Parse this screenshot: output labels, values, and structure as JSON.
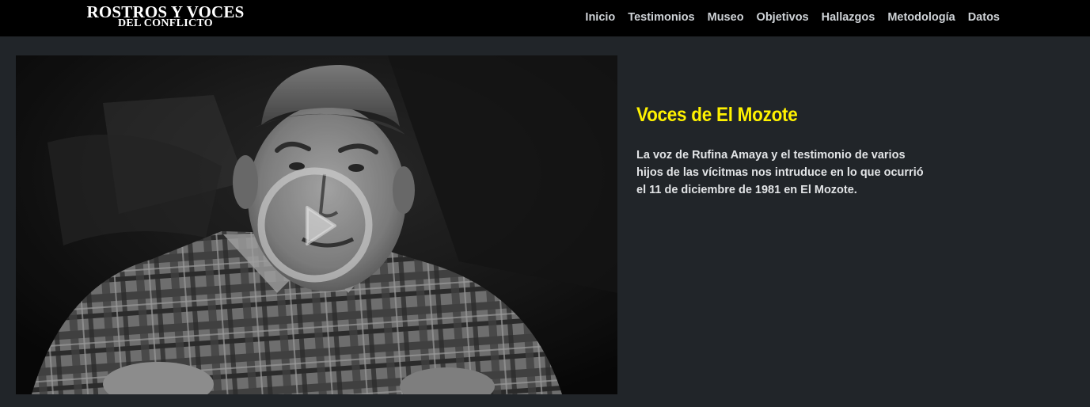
{
  "nav": {
    "logo_line1": "ROSTROS Y VOCES",
    "logo_line2": "DEL CONFLICTO",
    "items": [
      {
        "label": "Inicio"
      },
      {
        "label": "Testimonios"
      },
      {
        "label": "Museo"
      },
      {
        "label": "Objetivos"
      },
      {
        "label": "Hallazgos"
      },
      {
        "label": "Metodología"
      },
      {
        "label": "Datos"
      }
    ]
  },
  "video": {
    "thumbnail": "black-and-white-portrait",
    "play_icon": "play-circle-icon"
  },
  "info": {
    "title": "Voces de El Mozote",
    "description": "La voz de Rufina Amaya y el testimonio de varios hijos de las vícitmas nos intruduce en lo que ocurrió el 11 de diciembre de 1981 en El Mozote."
  },
  "colors": {
    "background": "#212529",
    "navbar": "#000000",
    "title_accent": "#fff200",
    "nav_text": "#cfd3d7"
  }
}
